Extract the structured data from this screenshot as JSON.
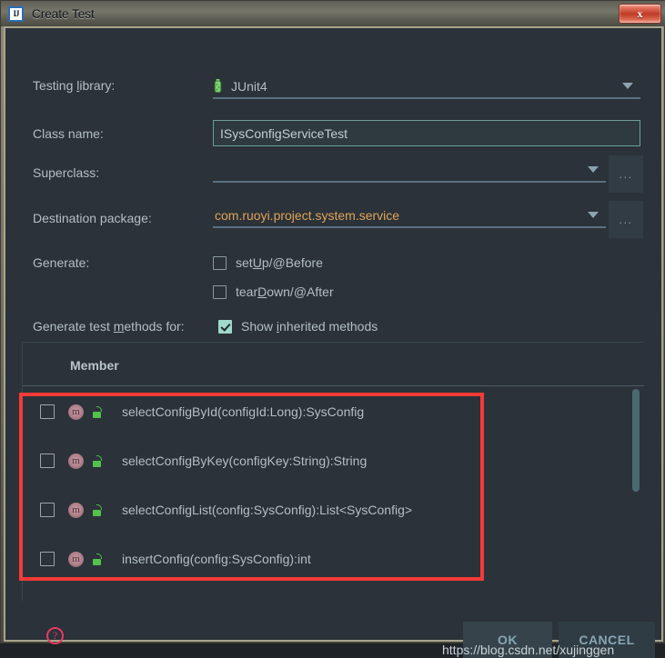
{
  "window": {
    "title": "Create Test",
    "app_icon": "intellij-idea-icon",
    "close_label": "x"
  },
  "form": {
    "testing_library": {
      "label_pre": "Testing ",
      "label_mnemonic": "l",
      "label_post": "ibrary:",
      "value": "JUnit4",
      "icon": "test-tube-icon"
    },
    "class_name": {
      "label": "Class name:",
      "value": "ISysConfigServiceTest",
      "placeholder": ""
    },
    "superclass": {
      "label": "Superclass:",
      "value": "",
      "browse_label": "..."
    },
    "destination_package": {
      "label": "Destination package:",
      "value": "com.ruoyi.project.system.service",
      "value_color": "#e0a458",
      "browse_label": "..."
    },
    "generate": {
      "label": "Generate:",
      "options": [
        {
          "pre": "set",
          "mnemonic": "U",
          "post": "p/@Before",
          "checked": false
        },
        {
          "pre": "tear",
          "mnemonic": "D",
          "post": "own/@After",
          "checked": false
        }
      ]
    },
    "generate_test_methods": {
      "label_pre": "Generate test ",
      "label_mnemonic": "m",
      "label_post": "ethods for:",
      "show_inherited": {
        "pre": "Show ",
        "mnemonic": "i",
        "post": "nherited methods",
        "checked": true
      }
    }
  },
  "member_table": {
    "column_header": "Member",
    "rows": [
      {
        "signature": "selectConfigById(configId:Long):SysConfig",
        "checked": false,
        "kind_icon": "method-icon",
        "access_icon": "public-unlock-icon"
      },
      {
        "signature": "selectConfigByKey(configKey:String):String",
        "checked": false,
        "kind_icon": "method-icon",
        "access_icon": "public-unlock-icon"
      },
      {
        "signature": "selectConfigList(config:SysConfig):List<SysConfig>",
        "checked": false,
        "kind_icon": "method-icon",
        "access_icon": "public-unlock-icon"
      },
      {
        "signature": "insertConfig(config:SysConfig):int",
        "checked": false,
        "kind_icon": "method-icon",
        "access_icon": "public-unlock-icon"
      }
    ]
  },
  "footer": {
    "help_label": "?",
    "ok_label": "OK",
    "cancel_label": "CANCEL"
  },
  "annotation": {
    "highlight_color": "#f43a37"
  },
  "watermark": {
    "text": "https://blog.csdn.net/xujinggen"
  }
}
